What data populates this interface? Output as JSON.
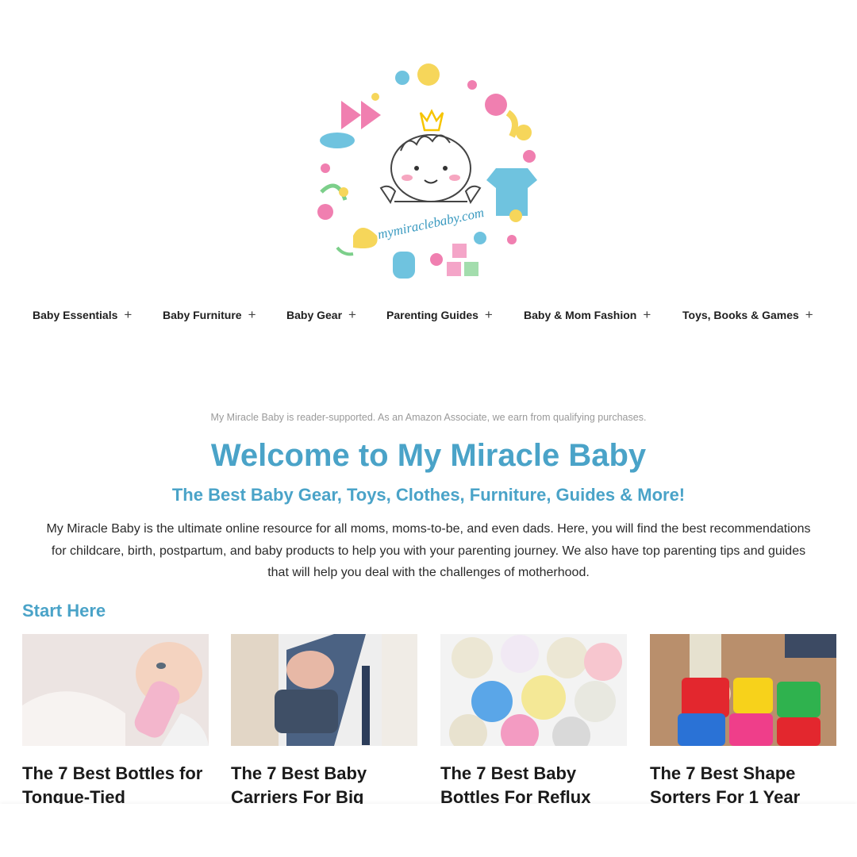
{
  "brand": {
    "logo_text": "mymiraclebaby.com"
  },
  "nav": [
    {
      "label": "Baby Essentials"
    },
    {
      "label": "Baby Furniture"
    },
    {
      "label": "Baby Gear"
    },
    {
      "label": "Parenting Guides"
    },
    {
      "label": "Baby & Mom Fashion"
    },
    {
      "label": "Toys, Books & Games"
    }
  ],
  "disclosure": "My Miracle Baby is reader-supported. As an Amazon Associate, we earn from qualifying purchases.",
  "hero": {
    "title": "Welcome to My Miracle Baby",
    "subtitle": "The Best Baby Gear, Toys, Clothes, Furniture, Guides & More!",
    "intro": "My Miracle Baby is the ultimate online resource for all moms, moms-to-be, and even dads. Here, you will find the best recommendations for childcare, birth, postpartum, and baby products to help you with your parenting journey. We also have top parenting tips and guides that will help you deal with the challenges of motherhood."
  },
  "start_here": {
    "heading": "Start Here",
    "cards": [
      {
        "title": "The 7 Best Bottles for Tongue-Tied"
      },
      {
        "title": "The 7 Best Baby Carriers For Big"
      },
      {
        "title": "The 7 Best Baby Bottles For Reflux"
      },
      {
        "title": "The 7 Best Shape Sorters For 1 Year"
      }
    ]
  },
  "colors": {
    "accent": "#4aa3c8",
    "text": "#222222",
    "muted": "#9a9a9a"
  }
}
